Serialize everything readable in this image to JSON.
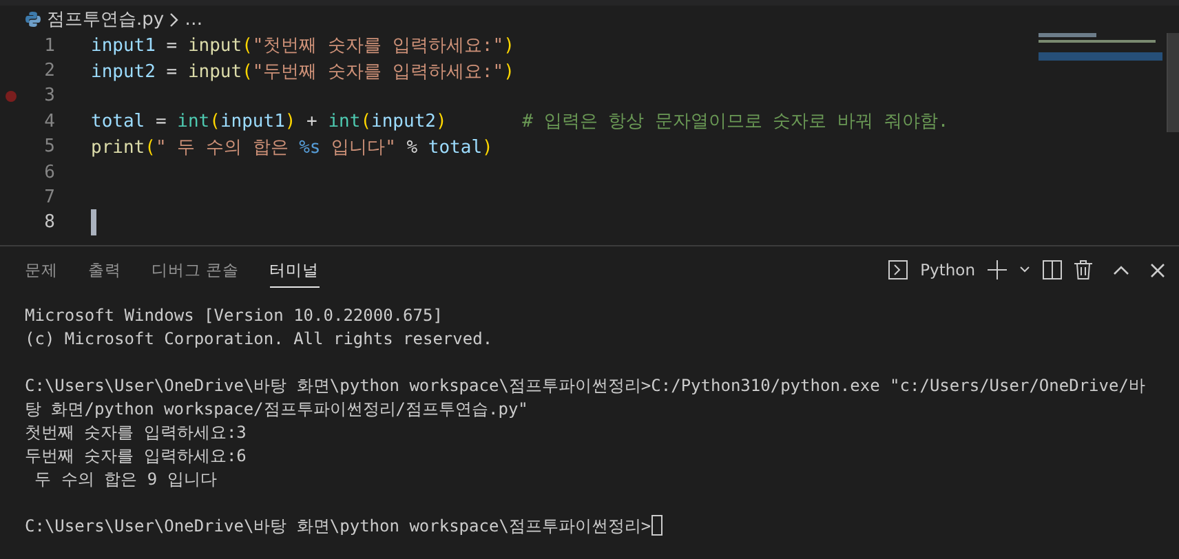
{
  "breadcrumb": {
    "file": "점프투연습.py",
    "more": "…"
  },
  "editor": {
    "lines": [
      {
        "number": "1",
        "breakpoint": false,
        "current": false,
        "tokens": [
          {
            "kind": "var",
            "text": "input1"
          },
          {
            "kind": "op",
            "text": " = "
          },
          {
            "kind": "func",
            "text": "input"
          },
          {
            "kind": "bracket",
            "text": "("
          },
          {
            "kind": "string",
            "text": "\"첫번째 숫자를 입력하세요:\""
          },
          {
            "kind": "bracket",
            "text": ")"
          }
        ]
      },
      {
        "number": "2",
        "breakpoint": false,
        "current": false,
        "tokens": [
          {
            "kind": "var",
            "text": "input2"
          },
          {
            "kind": "op",
            "text": " = "
          },
          {
            "kind": "func",
            "text": "input"
          },
          {
            "kind": "bracket",
            "text": "("
          },
          {
            "kind": "string",
            "text": "\"두번째 숫자를 입력하세요:\""
          },
          {
            "kind": "bracket",
            "text": ")"
          }
        ]
      },
      {
        "number": "3",
        "breakpoint": true,
        "current": false
      },
      {
        "number": "4",
        "breakpoint": false,
        "current": false,
        "tokens": [
          {
            "kind": "var",
            "text": "total"
          },
          {
            "kind": "op",
            "text": " = "
          },
          {
            "kind": "builtin",
            "text": "int"
          },
          {
            "kind": "bracket",
            "text": "("
          },
          {
            "kind": "var",
            "text": "input1"
          },
          {
            "kind": "bracket",
            "text": ")"
          },
          {
            "kind": "op",
            "text": " + "
          },
          {
            "kind": "builtin",
            "text": "int"
          },
          {
            "kind": "bracket",
            "text": "("
          },
          {
            "kind": "var",
            "text": "input2"
          },
          {
            "kind": "bracket",
            "text": ")"
          },
          {
            "kind": "comment",
            "text": "# 입력은 항상 문자열이므로 숫자로 바꿔 줘야함."
          }
        ]
      },
      {
        "number": "5",
        "breakpoint": false,
        "current": false,
        "tokens": [
          {
            "kind": "func",
            "text": "print"
          },
          {
            "kind": "bracket",
            "text": "("
          },
          {
            "kind": "string",
            "text": "\" 두 수의 합은 "
          },
          {
            "kind": "format",
            "text": "%s"
          },
          {
            "kind": "string",
            "text": " 입니다\""
          },
          {
            "kind": "op",
            "text": " % "
          },
          {
            "kind": "var",
            "text": "total"
          },
          {
            "kind": "bracket",
            "text": ")"
          }
        ]
      },
      {
        "number": "6",
        "breakpoint": false,
        "current": false
      },
      {
        "number": "7",
        "breakpoint": false,
        "current": false
      },
      {
        "number": "8",
        "breakpoint": false,
        "current": true
      }
    ]
  },
  "panel": {
    "tabs": [
      {
        "label": "문제",
        "selected": false
      },
      {
        "label": "출력",
        "selected": false
      },
      {
        "label": "디버그 콘솔",
        "selected": false
      },
      {
        "label": "터미널",
        "selected": true
      }
    ],
    "terminal_name": "Python",
    "terminal_lines": [
      {
        "kind": "text",
        "text": "Microsoft Windows [Version 10.0.22000.675]"
      },
      {
        "kind": "text",
        "text": "(c) Microsoft Corporation. All rights reserved."
      },
      {
        "kind": "blank"
      },
      {
        "kind": "text",
        "text": "C:\\Users\\User\\OneDrive\\바탕 화면\\python workspace\\점프투파이썬정리>C:/Python310/python.exe \"c:/Users/User/OneDrive/바"
      },
      {
        "kind": "text",
        "text": "탕 화면/python workspace/점프투파이썬정리/점프투연습.py\""
      },
      {
        "kind": "text",
        "text": "첫번째 숫자를 입력하세요:3"
      },
      {
        "kind": "text",
        "text": "두번째 숫자를 입력하세요:6"
      },
      {
        "kind": "text",
        "text": " 두 수의 합은 9 입니다"
      },
      {
        "kind": "blank"
      },
      {
        "kind": "prompt",
        "text": "C:\\Users\\User\\OneDrive\\바탕 화면\\python workspace\\점프투파이썬정리>"
      }
    ]
  }
}
